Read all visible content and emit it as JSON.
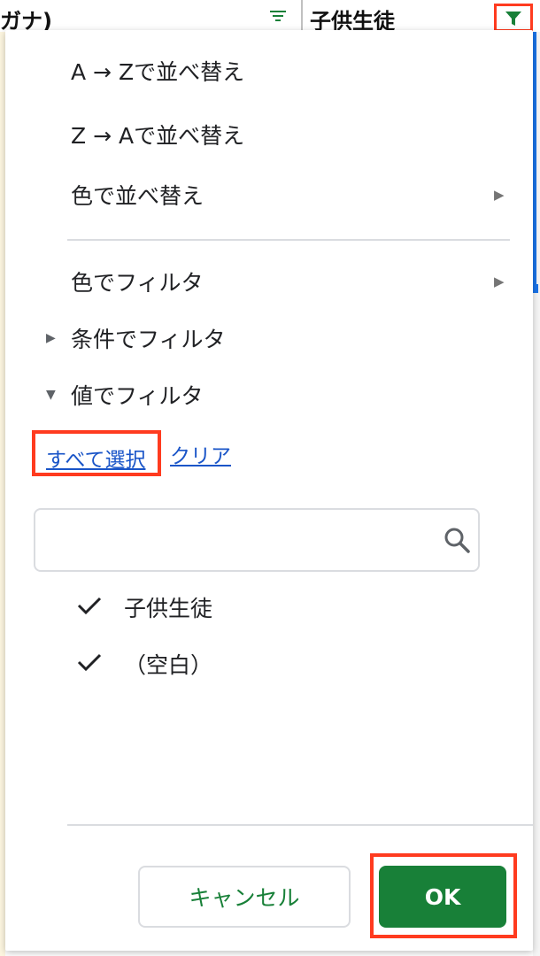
{
  "sheet": {
    "col_a_title": "ガナ)",
    "col_b_title": "子供生徒"
  },
  "menu": {
    "sort_az": "A → Zで並べ替え",
    "sort_za": "Z → Aで並べ替え",
    "sort_by_color": "色で並べ替え",
    "filter_by_color": "色でフィルタ",
    "filter_by_condition": "条件でフィルタ",
    "filter_by_values": "値でフィルタ"
  },
  "values_filter": {
    "select_all": "すべて選択",
    "clear": "クリア",
    "search_value": "",
    "items": [
      {
        "label": "子供生徒",
        "checked": true
      },
      {
        "label": "（空白）",
        "checked": true
      }
    ]
  },
  "buttons": {
    "cancel": "キャンセル",
    "ok": "OK"
  },
  "colors": {
    "accent_green": "#188038",
    "link_blue": "#1a55c8",
    "highlight_red": "#ff3b1f",
    "selection_blue": "#1a73e8"
  },
  "icons": {
    "col_a_filter": "filter-lines-icon",
    "col_b_filter": "funnel-filled-icon",
    "submenu": "triangle-right-icon",
    "collapsed": "triangle-right-icon",
    "expanded": "triangle-down-icon",
    "search": "magnifier-icon",
    "check": "checkmark-icon"
  }
}
